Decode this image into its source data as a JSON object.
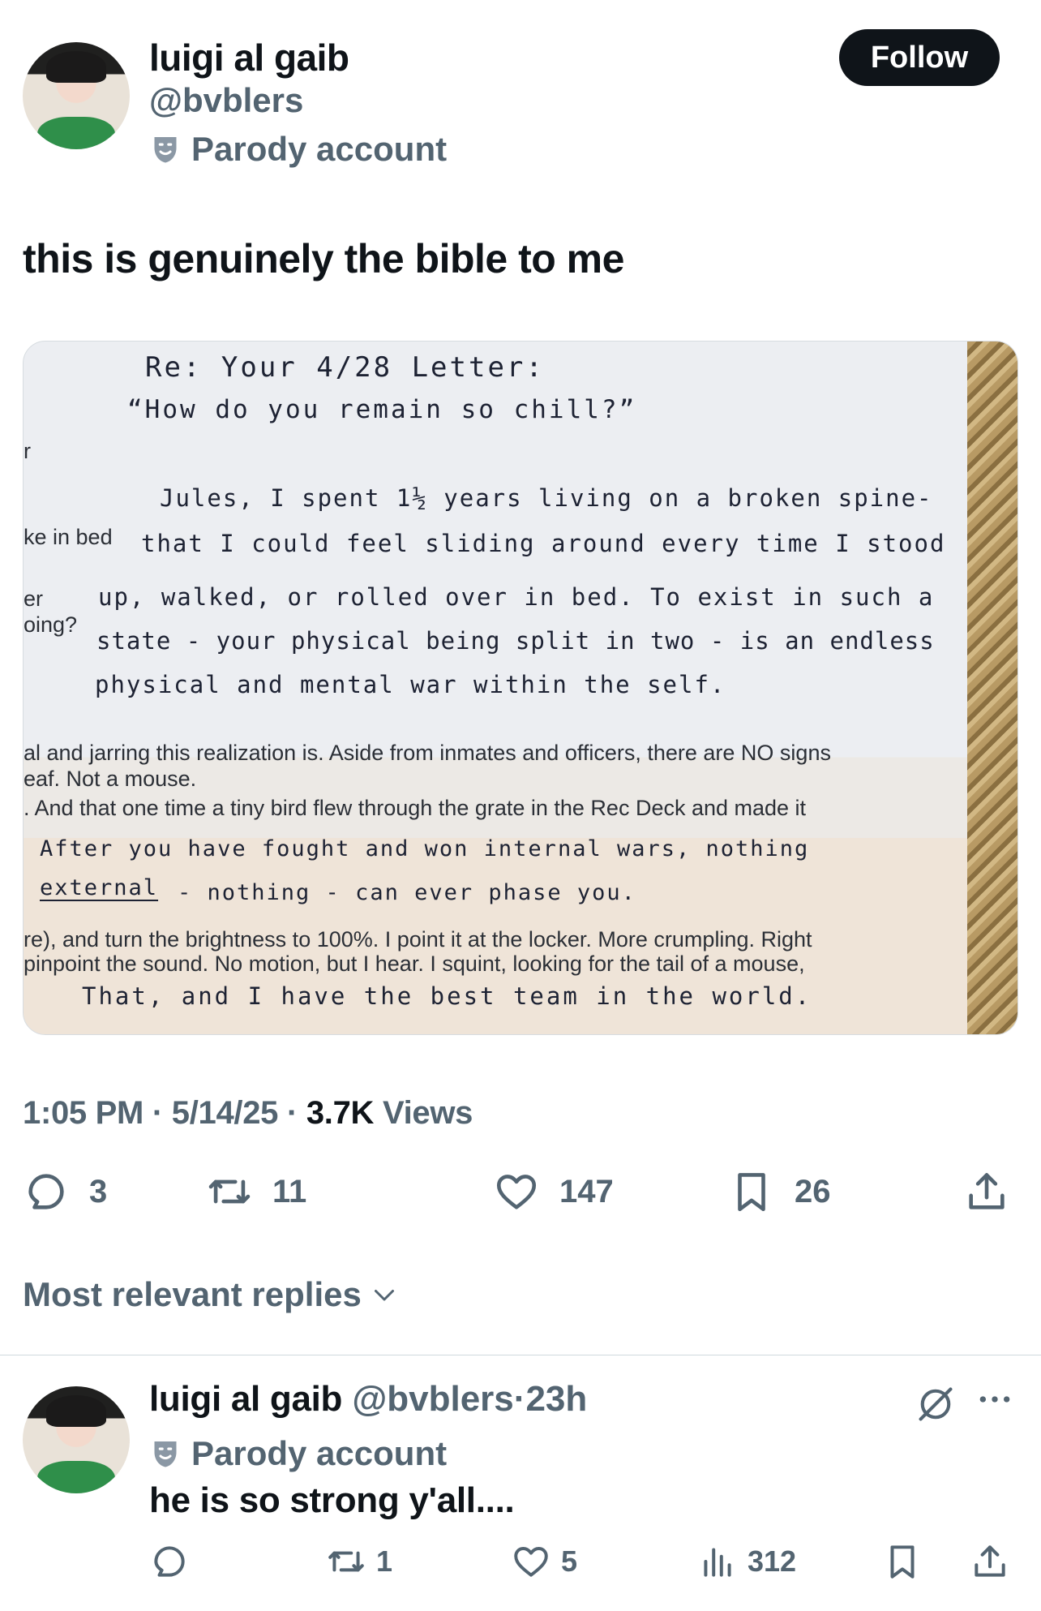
{
  "post": {
    "author_name": "luigi al gaib",
    "author_handle": "@bvblers",
    "parody_label": "Parody account",
    "follow_label": "Follow",
    "text": "this is genuinely the bible to me",
    "time": "1:05 PM",
    "date": "5/14/25",
    "views_count": "3.7K",
    "views_label": "Views",
    "separator": "·"
  },
  "media_letter": {
    "lines": [
      "Re: Your 4/28 Letter:",
      "“How do you remain so chill?”",
      "r",
      "Jules, I spent 1½ years living on a broken spine-",
      "ke in bed",
      "that I could feel sliding around every time I stood",
      "er",
      "oing?",
      "up, walked, or rolled over in bed. To exist in such a",
      "state - your physical being split in two - is an endless",
      "physical and mental war within the self.",
      "al and jarring this realization is. Aside from inmates and officers, there are NO signs",
      "eaf. Not a mouse.",
      ". And that one time a tiny bird flew through the grate in the Rec Deck and made it",
      "After you have fought and won internal wars, nothing",
      "external",
      "- nothing - can ever phase you.",
      "re), and turn the brightness to 100%. I point it at the locker. More crumpling. Right",
      "pinpoint the sound. No motion, but I hear. I squint, looking for the tail of a mouse,",
      "That, and I have the best team in the world."
    ]
  },
  "actions": {
    "replies": "3",
    "reposts": "11",
    "likes": "147",
    "bookmarks": "26"
  },
  "replies_sort_label": "Most relevant replies",
  "reply": {
    "author_name": "luigi al gaib",
    "author_handle": "@bvblers",
    "separator": "·",
    "time_ago": "23h",
    "parody_label": "Parody account",
    "text": "he is so strong y'all....",
    "reposts": "1",
    "likes": "5",
    "views": "312"
  },
  "colors": {
    "text_primary": "#0f1419",
    "text_secondary": "#536471",
    "follow_bg": "#0f1419",
    "divider": "#cfd9de"
  }
}
